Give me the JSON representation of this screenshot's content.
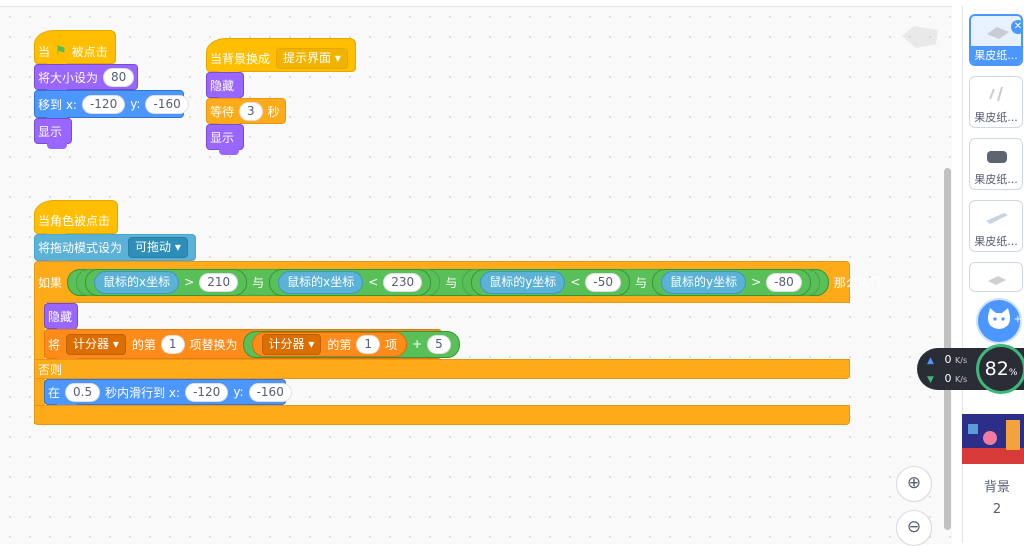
{
  "scripts": {
    "flag_script": {
      "hat_prefix": "当",
      "hat_suffix": "被点击",
      "set_size": {
        "label": "将大小设为",
        "value": "80"
      },
      "go_to": {
        "label": "移到 x:",
        "x": "-120",
        "y_label": "y:",
        "y": "-160"
      },
      "show": "显示"
    },
    "backdrop_script": {
      "hat_label": "当背景换成",
      "backdrop": "提示界面",
      "hide": "隐藏",
      "wait": {
        "label": "等待",
        "value": "3",
        "unit": "秒"
      },
      "show": "显示"
    },
    "sprite_click_script": {
      "hat": "当角色被点击",
      "drag_mode": {
        "label": "将拖动模式设为",
        "value": "可拖动"
      },
      "if_label": "如果",
      "then_label": "那么执行",
      "and_label": "与",
      "conditions": [
        {
          "reporter": "鼠标的x坐标",
          "op": ">",
          "value": "210"
        },
        {
          "reporter": "鼠标的x坐标",
          "op": "<",
          "value": "230"
        },
        {
          "reporter": "鼠标的y坐标",
          "op": "<",
          "value": "-50"
        },
        {
          "reporter": "鼠标的y坐标",
          "op": ">",
          "value": "-80"
        }
      ],
      "hide": "隐藏",
      "replace": {
        "label_1": "将",
        "list": "计分器",
        "label_2": "的第",
        "index": "1",
        "label_3": "项替换为",
        "item_list": "计分器",
        "item_label": "的第",
        "item_index": "1",
        "item_suffix": "项",
        "plus": "+",
        "add": "5"
      },
      "else_label": "否则",
      "glide": {
        "label_1": "在",
        "secs": "0.5",
        "label_2": "秒内滑行到 x:",
        "x": "-120",
        "y_label": "y:",
        "y": "-160"
      }
    }
  },
  "sprite_panel": {
    "items": [
      {
        "name": "果皮纸...",
        "selected": true
      },
      {
        "name": "果皮纸..."
      },
      {
        "name": "果皮纸..."
      },
      {
        "name": "果皮纸..."
      }
    ],
    "stage_label": "背景",
    "stage_count": "2"
  },
  "net_widget": {
    "upload": "0",
    "download": "0",
    "unit": "K/s",
    "cpu": "82",
    "cpu_unit": "%"
  },
  "colors": {
    "events": "#ffbf00",
    "looks": "#9966ff",
    "motion": "#4c97ff",
    "control": "#ffab19",
    "sensing": "#5cb1d6",
    "operators": "#59c059",
    "variables": "#ff8c1a"
  }
}
